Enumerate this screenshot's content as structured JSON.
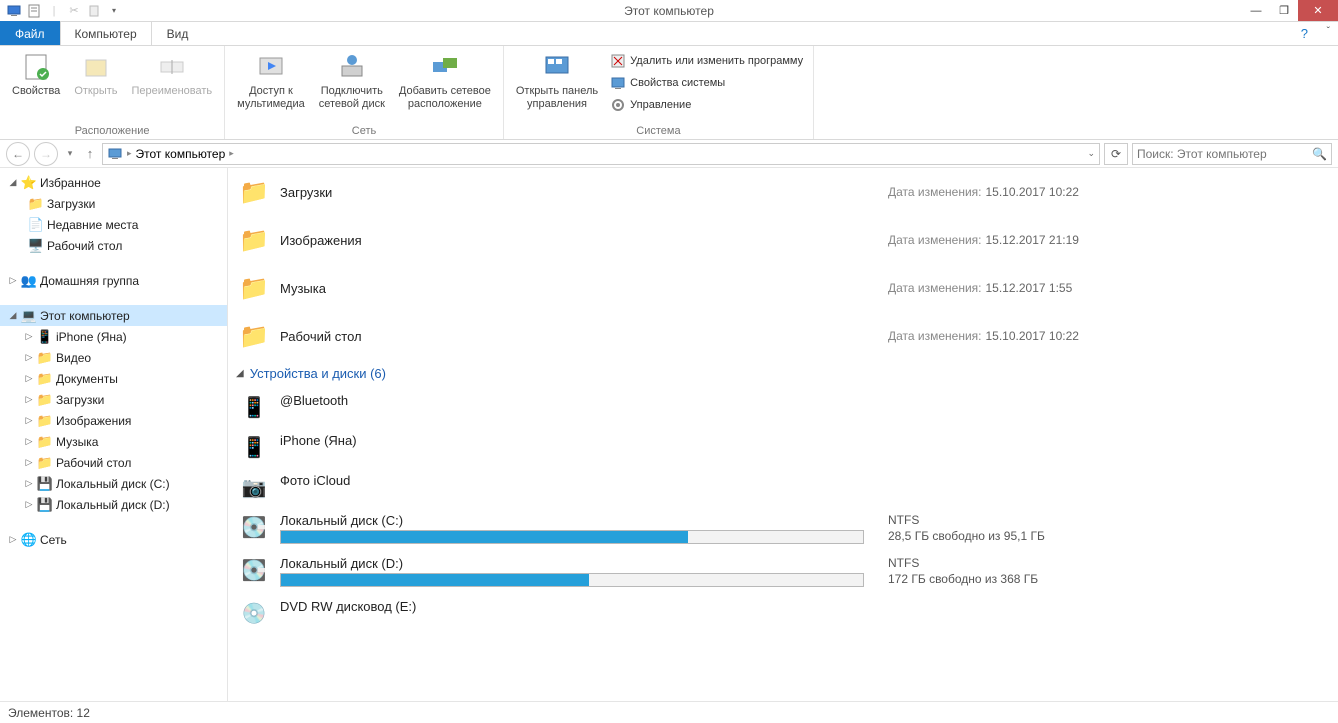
{
  "window": {
    "title": "Этот компьютер"
  },
  "tabs": {
    "file": "Файл",
    "computer": "Компьютер",
    "view": "Вид"
  },
  "ribbon": {
    "properties": "Свойства",
    "open": "Открыть",
    "rename": "Переименовать",
    "location_group": "Расположение",
    "media_access": "Доступ к\nмультимедиа",
    "map_drive": "Подключить\nсетевой диск",
    "add_network": "Добавить сетевое\nрасположение",
    "network_group": "Сеть",
    "open_cp": "Открыть панель\nуправления",
    "uninstall": "Удалить или изменить программу",
    "sys_props": "Свойства системы",
    "manage": "Управление",
    "system_group": "Система"
  },
  "breadcrumb": {
    "root": "Этот компьютер"
  },
  "search": {
    "placeholder": "Поиск: Этот компьютер"
  },
  "sidebar": {
    "favorites": "Избранное",
    "downloads": "Загрузки",
    "recent": "Недавние места",
    "desktop": "Рабочий стол",
    "homegroup": "Домашняя группа",
    "this_pc": "Этот компьютер",
    "iphone": "iPhone (Яна)",
    "video": "Видео",
    "documents": "Документы",
    "downloads2": "Загрузки",
    "pictures": "Изображения",
    "music": "Музыка",
    "desktop2": "Рабочий стол",
    "disk_c": "Локальный диск (C:)",
    "disk_d": "Локальный диск (D:)",
    "network": "Сеть"
  },
  "content": {
    "date_label": "Дата изменения:",
    "folders": [
      {
        "name": "Загрузки",
        "date": "15.10.2017 10:22"
      },
      {
        "name": "Изображения",
        "date": "15.12.2017 21:19"
      },
      {
        "name": "Музыка",
        "date": "15.12.2017 1:55"
      },
      {
        "name": "Рабочий стол",
        "date": "15.10.2017 10:22"
      }
    ],
    "devices_header": "Устройства и диски (6)",
    "devices": [
      {
        "name": "@Bluetooth",
        "type": "simple"
      },
      {
        "name": "iPhone (Яна)",
        "type": "simple"
      },
      {
        "name": "Фото iCloud",
        "type": "simple"
      },
      {
        "name": "Локальный диск (C:)",
        "type": "drive",
        "fs": "NTFS",
        "free": "28,5 ГБ свободно из 95,1 ГБ",
        "fill_pct": 70
      },
      {
        "name": "Локальный диск (D:)",
        "type": "drive",
        "fs": "NTFS",
        "free": "172 ГБ свободно из 368 ГБ",
        "fill_pct": 53
      },
      {
        "name": "DVD RW дисковод (E:)",
        "type": "simple"
      }
    ]
  },
  "status": {
    "count_label": "Элементов:",
    "count": "12"
  }
}
